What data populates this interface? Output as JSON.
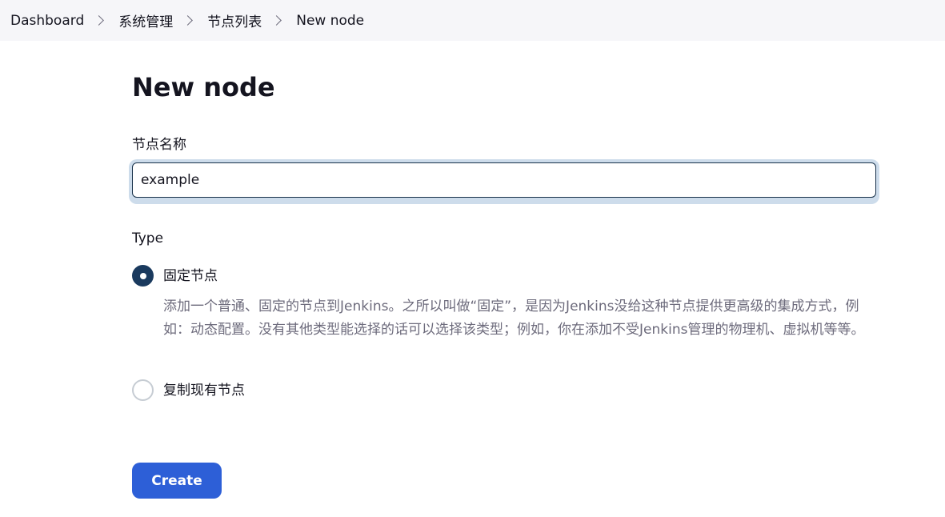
{
  "breadcrumb": {
    "items": [
      {
        "label": "Dashboard"
      },
      {
        "label": "系统管理"
      },
      {
        "label": "节点列表"
      },
      {
        "label": "New node"
      }
    ],
    "separator_icon": "chevron-right-icon"
  },
  "page": {
    "title": "New node"
  },
  "form": {
    "name_label": "节点名称",
    "name_value": "example",
    "type_label": "Type",
    "options": [
      {
        "label": "固定节点",
        "checked": true,
        "description": "添加一个普通、固定的节点到Jenkins。之所以叫做“固定”，是因为Jenkins没给这种节点提供更高级的集成方式，例如：动态配置。没有其他类型能选择的话可以选择该类型；例如，你在添加不受Jenkins管理的物理机、虚拟机等等。"
      },
      {
        "label": "复制现有节点",
        "checked": false
      }
    ],
    "create_label": "Create"
  },
  "colors": {
    "accent": "#2d5fd7",
    "radio_checked": "#1a3a5e",
    "breadcrumb_bg": "#f6f6f9",
    "muted_text": "#6d6b7c"
  }
}
